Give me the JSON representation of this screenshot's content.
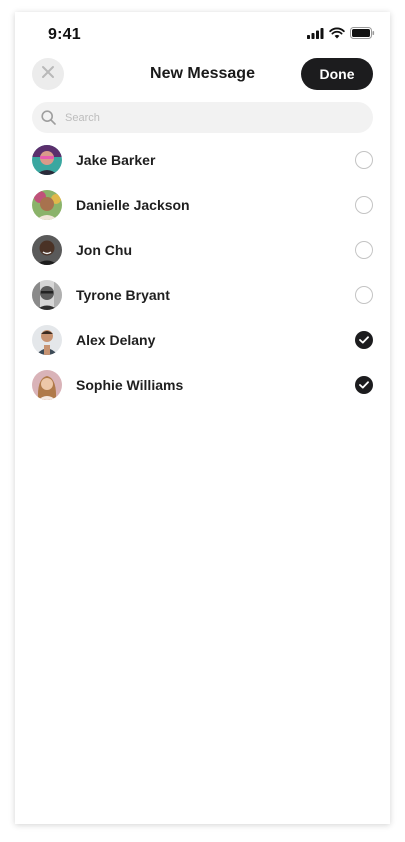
{
  "status_bar": {
    "time": "9:41"
  },
  "header": {
    "title": "New Message",
    "done_label": "Done",
    "close_icon": "close-icon"
  },
  "search": {
    "placeholder": "Search",
    "value": ""
  },
  "contacts": [
    {
      "name": "Jake Barker",
      "selected": false
    },
    {
      "name": "Danielle Jackson",
      "selected": false
    },
    {
      "name": "Jon Chu",
      "selected": false
    },
    {
      "name": "Tyrone Bryant",
      "selected": false
    },
    {
      "name": "Alex Delany",
      "selected": true
    },
    {
      "name": "Sophie Williams",
      "selected": true
    }
  ],
  "colors": {
    "accent_dark": "#1c1c1e",
    "search_bg": "#f2f2f2",
    "close_bg": "#ececec",
    "unchecked_border": "#c4c4c4"
  }
}
